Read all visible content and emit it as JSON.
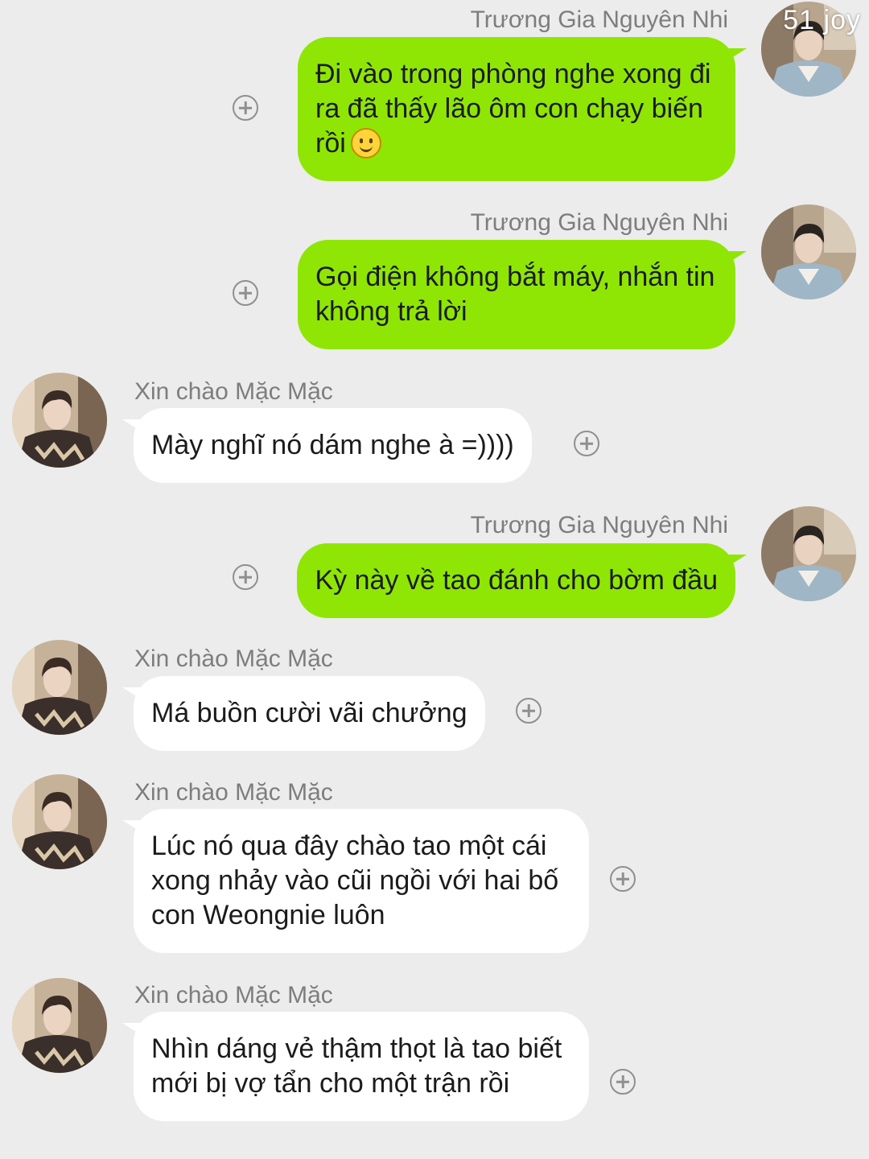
{
  "watermark": "51 joy",
  "messages": [
    {
      "sender": "Trương Gia Nguyên Nhi",
      "side": "sent",
      "text": "Đi vào trong phòng nghe xong đi ra đã thấy lão ôm con chạy biến rồi",
      "emoji": "smiling-face"
    },
    {
      "sender": "Trương Gia Nguyên Nhi",
      "side": "sent",
      "text": "Gọi điện không bắt máy, nhắn tin không trả lời"
    },
    {
      "sender": "Xin chào Mặc Mặc",
      "side": "received",
      "text": "Mày nghĩ nó dám nghe à =))))"
    },
    {
      "sender": "Trương Gia Nguyên Nhi",
      "side": "sent",
      "text": "Kỳ này về tao đánh cho bờm đầu"
    },
    {
      "sender": "Xin chào Mặc Mặc",
      "side": "received",
      "text": "Má buồn cười vãi chưởng"
    },
    {
      "sender": "Xin chào Mặc Mặc",
      "side": "received",
      "text": "Lúc nó qua đây chào tao một cái xong nhảy vào cũi ngồi với hai bố con Weongnie luôn"
    },
    {
      "sender": "Xin chào Mặc Mặc",
      "side": "received",
      "text": "Nhìn dáng vẻ thậm thọt là tao biết mới bị vợ tẩn cho một trận rồi"
    }
  ],
  "icons": {
    "add": "add-circle-icon",
    "emoji": "smiling-face-emoji"
  },
  "colors": {
    "sent_bubble": "#8fe605",
    "received_bubble": "#ffffff",
    "background": "#ececec"
  }
}
